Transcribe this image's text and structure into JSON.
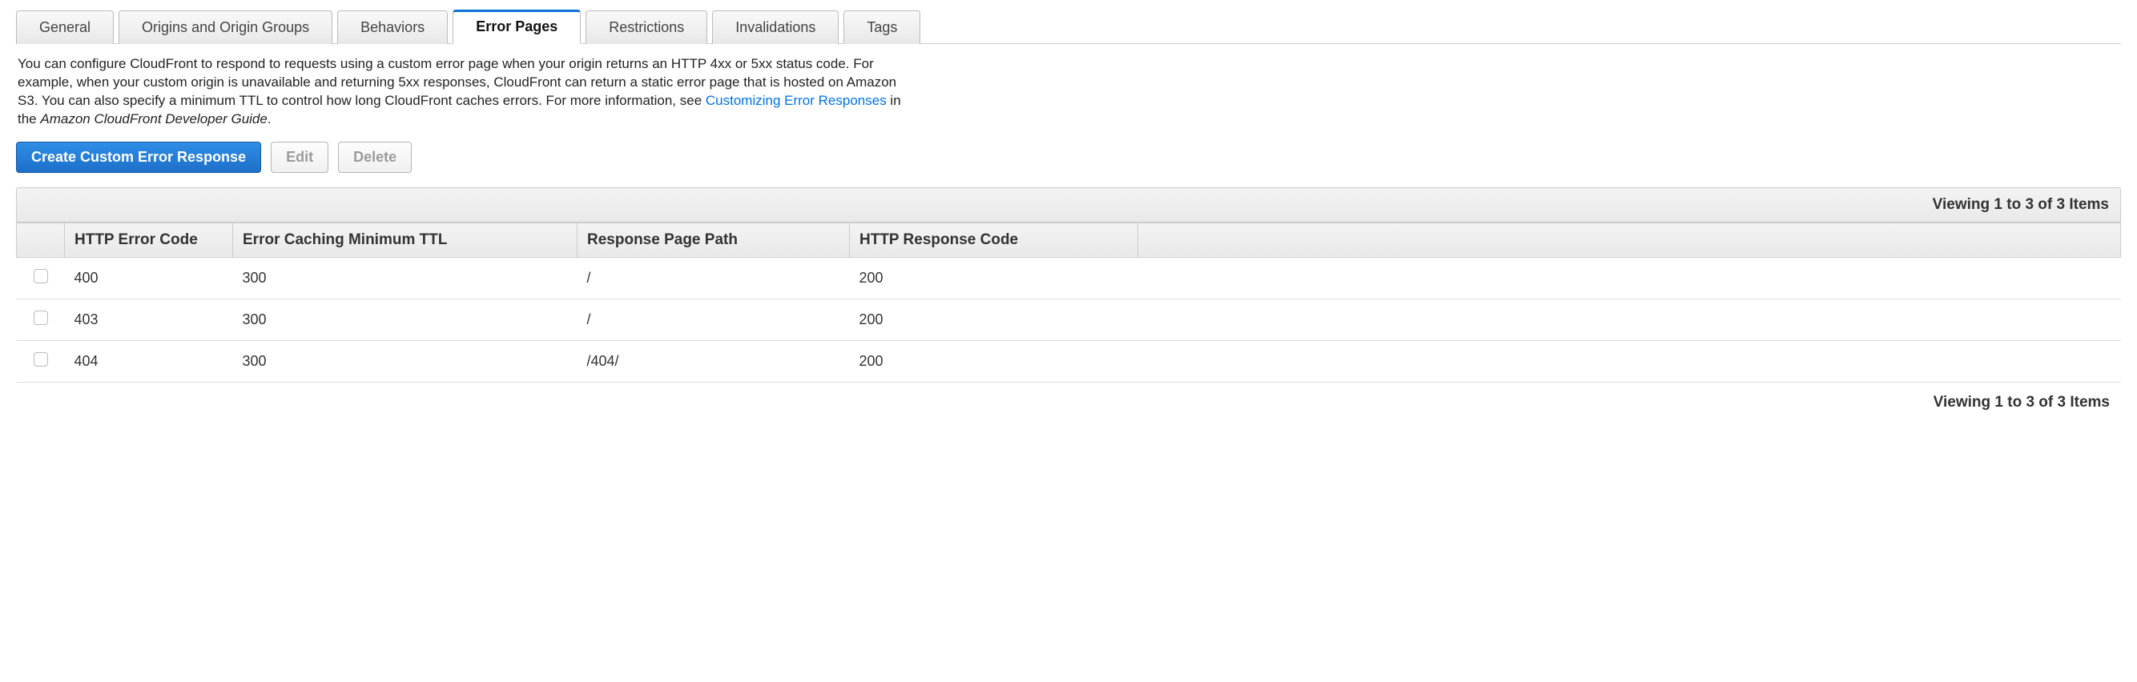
{
  "tabs": [
    {
      "label": "General",
      "active": false
    },
    {
      "label": "Origins and Origin Groups",
      "active": false
    },
    {
      "label": "Behaviors",
      "active": false
    },
    {
      "label": "Error Pages",
      "active": true
    },
    {
      "label": "Restrictions",
      "active": false
    },
    {
      "label": "Invalidations",
      "active": false
    },
    {
      "label": "Tags",
      "active": false
    }
  ],
  "description": {
    "part1": "You can configure CloudFront to respond to requests using a custom error page when your origin returns an HTTP 4xx or 5xx status code. For example, when your custom origin is unavailable and returning 5xx responses, CloudFront can return a static error page that is hosted on Amazon S3. You can also specify a minimum TTL to control how long CloudFront caches errors. For more information, see ",
    "link": "Customizing Error Responses",
    "part2": " in the ",
    "italic": "Amazon CloudFront Developer Guide",
    "part3": "."
  },
  "actions": {
    "create": "Create Custom Error Response",
    "edit": "Edit",
    "delete": "Delete"
  },
  "viewing_text": "Viewing 1 to 3 of 3 Items",
  "columns": {
    "http_error": "HTTP Error Code",
    "ttl": "Error Caching Minimum TTL",
    "path": "Response Page Path",
    "response_code": "HTTP Response Code"
  },
  "rows": [
    {
      "http_error": "400",
      "ttl": "300",
      "path": "/",
      "response_code": "200"
    },
    {
      "http_error": "403",
      "ttl": "300",
      "path": "/",
      "response_code": "200"
    },
    {
      "http_error": "404",
      "ttl": "300",
      "path": "/404/",
      "response_code": "200"
    }
  ]
}
